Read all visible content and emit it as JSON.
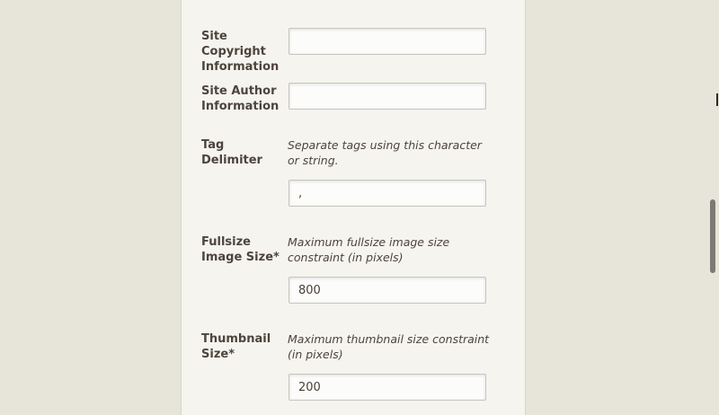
{
  "form": {
    "copyright": {
      "label": "Site\nCopyright\nInformation",
      "value": ""
    },
    "author": {
      "label": "Site Author\nInformation",
      "value": ""
    },
    "tag_delimiter": {
      "label": "Tag\nDelimiter",
      "help": "Separate tags using this character or string.",
      "value": ","
    },
    "fullsize": {
      "label": "Fullsize\nImage Size*",
      "help": "Maximum fullsize image size constraint (in pixels)",
      "value": "800"
    },
    "thumbnail": {
      "label": "Thumbnail\nSize*",
      "help": "Maximum thumbnail size constraint (in pixels)",
      "value": "200"
    }
  }
}
